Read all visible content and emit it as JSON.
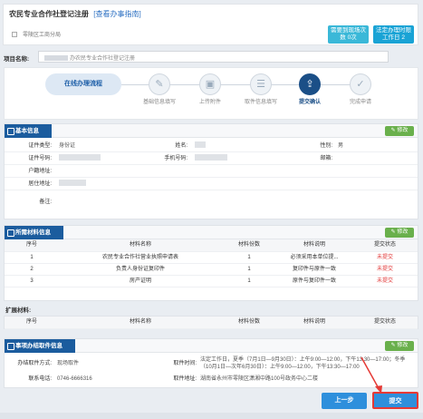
{
  "header": {
    "title": "农民专业合作社登记注册",
    "guide_link": "[查看办事指南]",
    "agency": "零陵区工商分局",
    "badge_visits": "需要到现场次数 0次",
    "badge_days": "法定办理时限工作日 2"
  },
  "project": {
    "label": "项目名称:",
    "value": "办农民专业合作社登记注册"
  },
  "flow": {
    "start_label": "在线办理流程",
    "steps": [
      {
        "label": "基础信息填写",
        "icon": "form-edit-icon"
      },
      {
        "label": "上传附件",
        "icon": "upload-image-icon"
      },
      {
        "label": "取件信息填写",
        "icon": "pickup-form-icon"
      },
      {
        "label": "提交确认",
        "icon": "submit-confirm-icon"
      },
      {
        "label": "完成申请",
        "icon": "complete-check-icon"
      }
    ]
  },
  "basic": {
    "title": "基本信息",
    "edit": "修改",
    "id_type_label": "证件类型:",
    "id_type_value": "身份证",
    "name_label": "姓名:",
    "gender_label": "性别:",
    "gender_value": "男",
    "id_no_label": "证件号码:",
    "phone_label": "手机号码:",
    "email_label": "邮箱:",
    "household_label": "户籍地址:",
    "address_label": "居住地址:",
    "remark_label": "备注:"
  },
  "materials": {
    "title": "所需材料信息",
    "edit": "修改",
    "columns": [
      "序号",
      "材料名称",
      "材料份数",
      "材料说明",
      "提交状态"
    ],
    "rows": [
      {
        "no": "1",
        "name": "农民专业合作社营业执照申请表",
        "count": "1",
        "desc": "必须采用本单位提...",
        "status": "未提交"
      },
      {
        "no": "2",
        "name": "负责人身份证复印件",
        "count": "1",
        "desc": "复印件与原件一致",
        "status": "未提交"
      },
      {
        "no": "3",
        "name": "房产证明",
        "count": "1",
        "desc": "原件与复印件一致",
        "status": "未提交"
      }
    ],
    "ext_label": "扩展材料:",
    "ext_columns": [
      "序号",
      "材料名称",
      "材料份数",
      "材料说明",
      "提交状态"
    ]
  },
  "pickup": {
    "title": "事项办结取件信息",
    "edit": "修改",
    "method_label": "办结取件方式:",
    "method_value": "现场取件",
    "time_label": "取件时间:",
    "time_value_1": "法定工作日，夏季（7月1日—9月30日）：上午9:00—12:00，下午13:30—17:00；冬季（10月1日—次年6月30日）：上午9:00—12:00，下午13:30—17:00",
    "phone_label": "联系电话:",
    "phone_value": "0746-6666316",
    "addr_label": "取件地址:",
    "addr_value": "湖南省永州市零陵区潇湘中路100号政务中心二楼"
  },
  "actions": {
    "prev": "上一步",
    "submit": "提交"
  }
}
